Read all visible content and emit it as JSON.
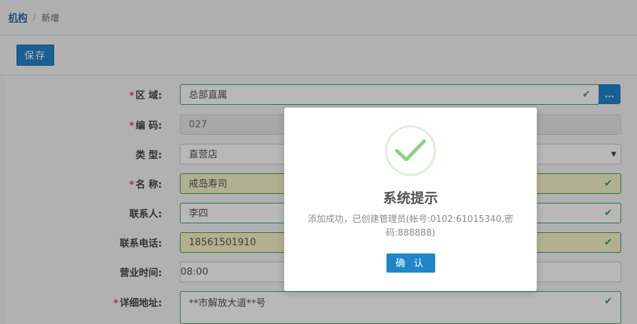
{
  "breadcrumb": {
    "parent": "机构",
    "separator": "/",
    "current": "新增"
  },
  "toolbar": {
    "save_label": "保存"
  },
  "form": {
    "region": {
      "label": "区 域:",
      "required": "*",
      "value": "总部直属",
      "browse": "..."
    },
    "code": {
      "label": "编 码:",
      "required": "*",
      "value": "027"
    },
    "type": {
      "label": "类 型:",
      "value": "直营店"
    },
    "name": {
      "label": "名 称:",
      "required": "*",
      "value": "戒岛寿司"
    },
    "contact": {
      "label": "联系人:",
      "value": "李四"
    },
    "phone": {
      "label": "联系电话:",
      "value": "18561501910"
    },
    "hours": {
      "label": "营业时间:",
      "value": "08:00"
    },
    "address": {
      "label": "详细地址:",
      "required": "*",
      "value": "**市解放大道**号"
    }
  },
  "dialog": {
    "title": "系统提示",
    "message": "添加成功，已创建管理员(帐号:0102:61015340,密码:888888)",
    "confirm_label": "确 认"
  },
  "colors": {
    "primary": "#2086c9",
    "success": "#3c9a5f",
    "required": "#d9534f"
  }
}
